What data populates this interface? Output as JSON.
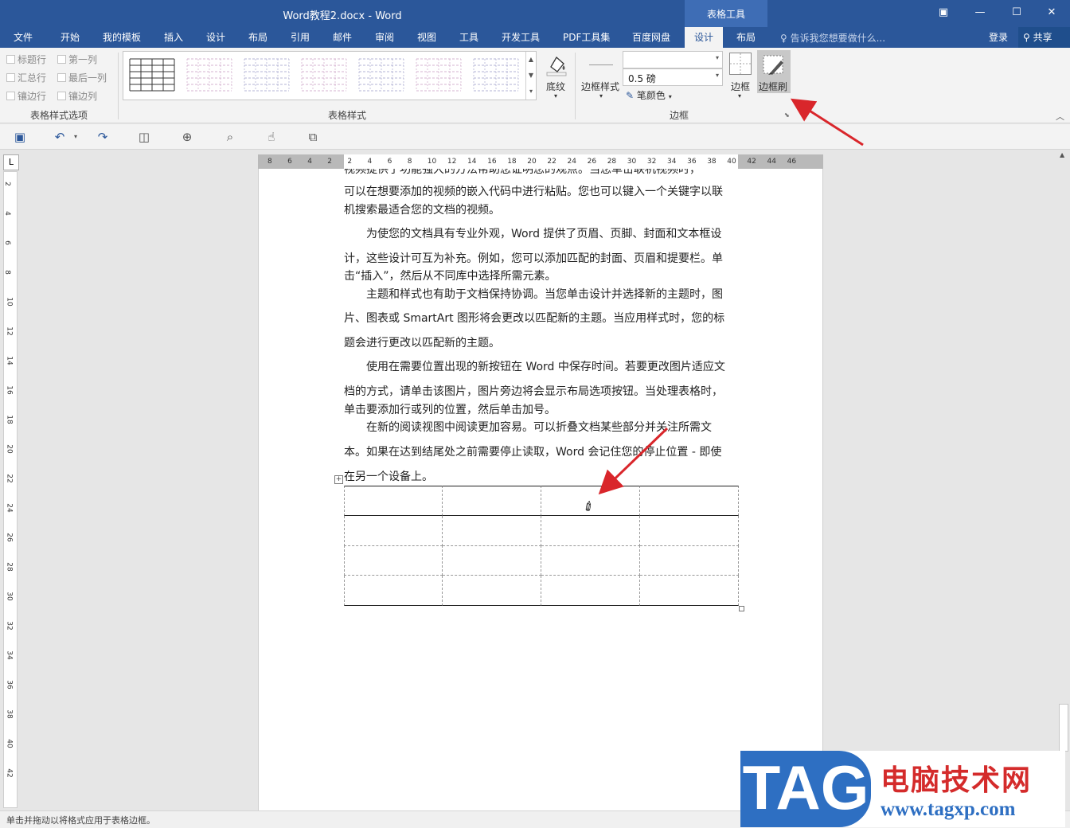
{
  "window": {
    "title": "Word教程2.docx - Word",
    "context_group": "表格工具",
    "controls": {
      "ribbon_display": "▣",
      "minimize": "—",
      "maximize": "☐",
      "close": "✕"
    }
  },
  "tabs": [
    "文件",
    "开始",
    "我的模板",
    "插入",
    "设计",
    "布局",
    "引用",
    "邮件",
    "审阅",
    "视图",
    "工具",
    "开发工具",
    "PDF工具集",
    "百度网盘",
    "设计",
    "布局"
  ],
  "active_tab": "设计",
  "tell_me": "告诉我您想要做什么...",
  "login": "登录",
  "share": "共享",
  "ribbon": {
    "style_options": {
      "items": [
        "标题行",
        "第一列",
        "汇总行",
        "最后一列",
        "镶边行",
        "镶边列"
      ],
      "group_label": "表格样式选项"
    },
    "table_styles": {
      "group_label": "表格样式",
      "count": 7
    },
    "shading_label": "底纹",
    "borders": {
      "border_styles_label": "边框样式",
      "line_style_value": "",
      "weight_value": "0.5 磅",
      "pen_color_label": "笔颜色",
      "borders_label": "边框",
      "border_painter_label": "边框刷",
      "group_label": "边框"
    }
  },
  "ruler": {
    "h_labels": [
      "8",
      "6",
      "4",
      "2",
      "2",
      "4",
      "6",
      "8",
      "10",
      "12",
      "14",
      "16",
      "18",
      "20",
      "22",
      "24",
      "26",
      "28",
      "30",
      "32",
      "34",
      "36",
      "38",
      "40",
      "42",
      "44",
      "46"
    ],
    "v_labels": [
      "2",
      "4",
      "6",
      "8",
      "10",
      "12",
      "14",
      "16",
      "18",
      "20",
      "22",
      "24",
      "26",
      "28",
      "30",
      "32",
      "34",
      "36",
      "38",
      "40",
      "42"
    ]
  },
  "document": {
    "paragraphs": [
      "视频提供了功能强大的方法帮助您证明您的观点。当您单击联机视频时，",
      "可以在想要添加的视频的嵌入代码中进行粘贴。您也可以键入一个关键字以联",
      "机搜索最适合您的文档的视频。",
      "为使您的文档具有专业外观，Word 提供了页眉、页脚、封面和文本框设",
      "计，这些设计可互为补充。例如，您可以添加匹配的封面、页眉和提要栏。单",
      "击“插入”，然后从不同库中选择所需元素。",
      "主题和样式也有助于文档保持协调。当您单击设计并选择新的主题时，图",
      "片、图表或 SmartArt 图形将会更改以匹配新的主题。当应用样式时，您的标",
      "题会进行更改以匹配新的主题。",
      "使用在需要位置出现的新按钮在 Word 中保存时间。若要更改图片适应文",
      "档的方式，请单击该图片，图片旁边将会显示布局选项按钮。当处理表格时，",
      "单击要添加行或列的位置，然后单击加号。",
      "在新的阅读视图中阅读更加容易。可以折叠文档某些部分并关注所需文",
      "本。如果在达到结尾处之前需要停止读取，Word 会记住您的停止位置 - 即使",
      "在另一个设备上。"
    ],
    "table": {
      "rows": 4,
      "cols": 4
    }
  },
  "status_bar": "单击并拖动以将格式应用于表格边框。",
  "watermark": {
    "logo": "TAG",
    "title": "电脑技术网",
    "url": "www.tagxp.com"
  },
  "colors": {
    "word_blue": "#2b579a",
    "arrow_red": "#d9262b",
    "tag_blue": "#2e6fc2"
  }
}
